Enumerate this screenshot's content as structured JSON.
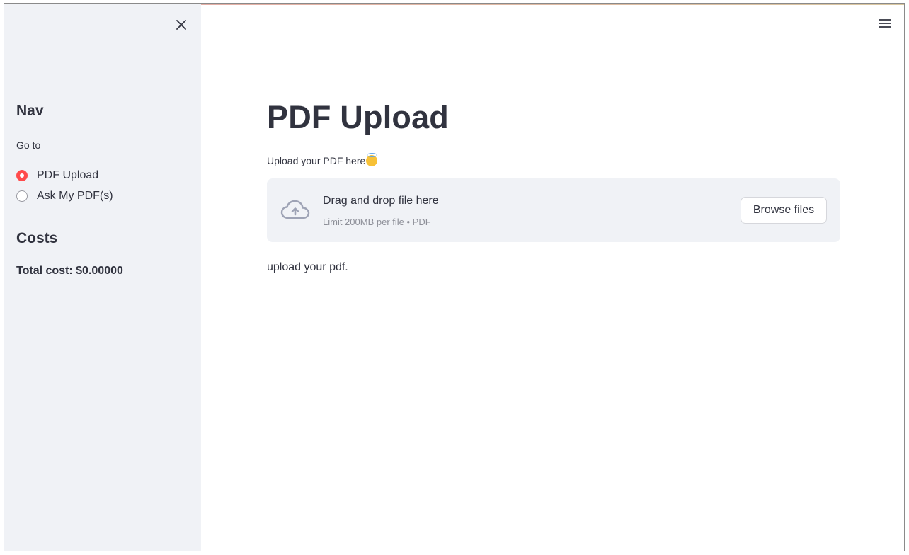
{
  "sidebar": {
    "nav_heading": "Nav",
    "goto_label": "Go to",
    "options": [
      {
        "label": "PDF Upload",
        "selected": true
      },
      {
        "label": "Ask My PDF(s)",
        "selected": false
      }
    ],
    "costs_heading": "Costs",
    "total_cost": "Total cost: $0.00000"
  },
  "main": {
    "title": "PDF Upload",
    "upload_label": "Upload your PDF here",
    "dropzone": {
      "title": "Drag and drop file here",
      "subtitle": "Limit 200MB per file • PDF",
      "browse_label": "Browse files"
    },
    "status_text": "upload your pdf."
  },
  "icons": {
    "close": "close-icon",
    "menu": "hamburger-menu-icon",
    "upload": "cloud-upload-icon",
    "emoji": "smiling-face-with-halo-icon"
  },
  "colors": {
    "accent": "#ff4b4b",
    "sidebar_bg": "#f0f2f6",
    "text": "#31333f"
  }
}
